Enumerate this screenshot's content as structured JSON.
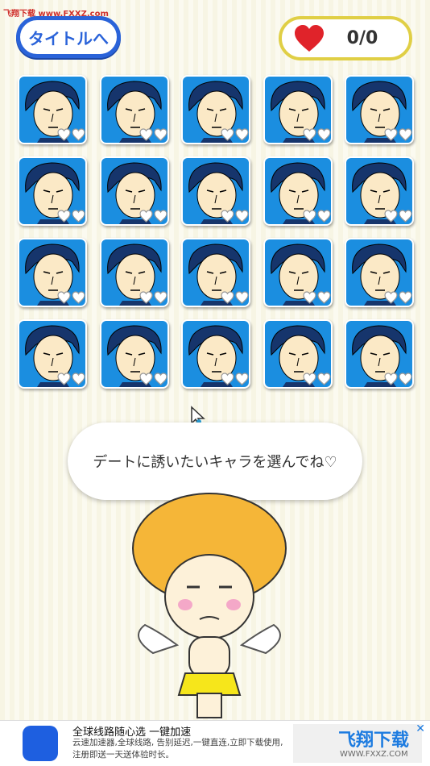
{
  "watermark": "飞翔下载 www.FXXZ.com",
  "header": {
    "title_button_label": "タイトルへ",
    "score": "0/0"
  },
  "grid": {
    "rows": 4,
    "cols": 5,
    "card_hearts_filled": 0
  },
  "dialog": {
    "message": "デートに誘いたいキャラを選んでね♡"
  },
  "ad": {
    "title": "全球线路随心选 一键加速",
    "body": "云速加速器,全球线路, 告别延迟,一键直连,立即下载使用, 注册即送一天送体验时长。",
    "brand": "飞翔下载",
    "brand_url": "WWW.FXXZ.COM",
    "close_label": "✕"
  },
  "colors": {
    "accent_blue": "#2a63d9",
    "score_border": "#e0cf45",
    "heart_red": "#e0232a",
    "card_bg": "#1b8ee0"
  }
}
